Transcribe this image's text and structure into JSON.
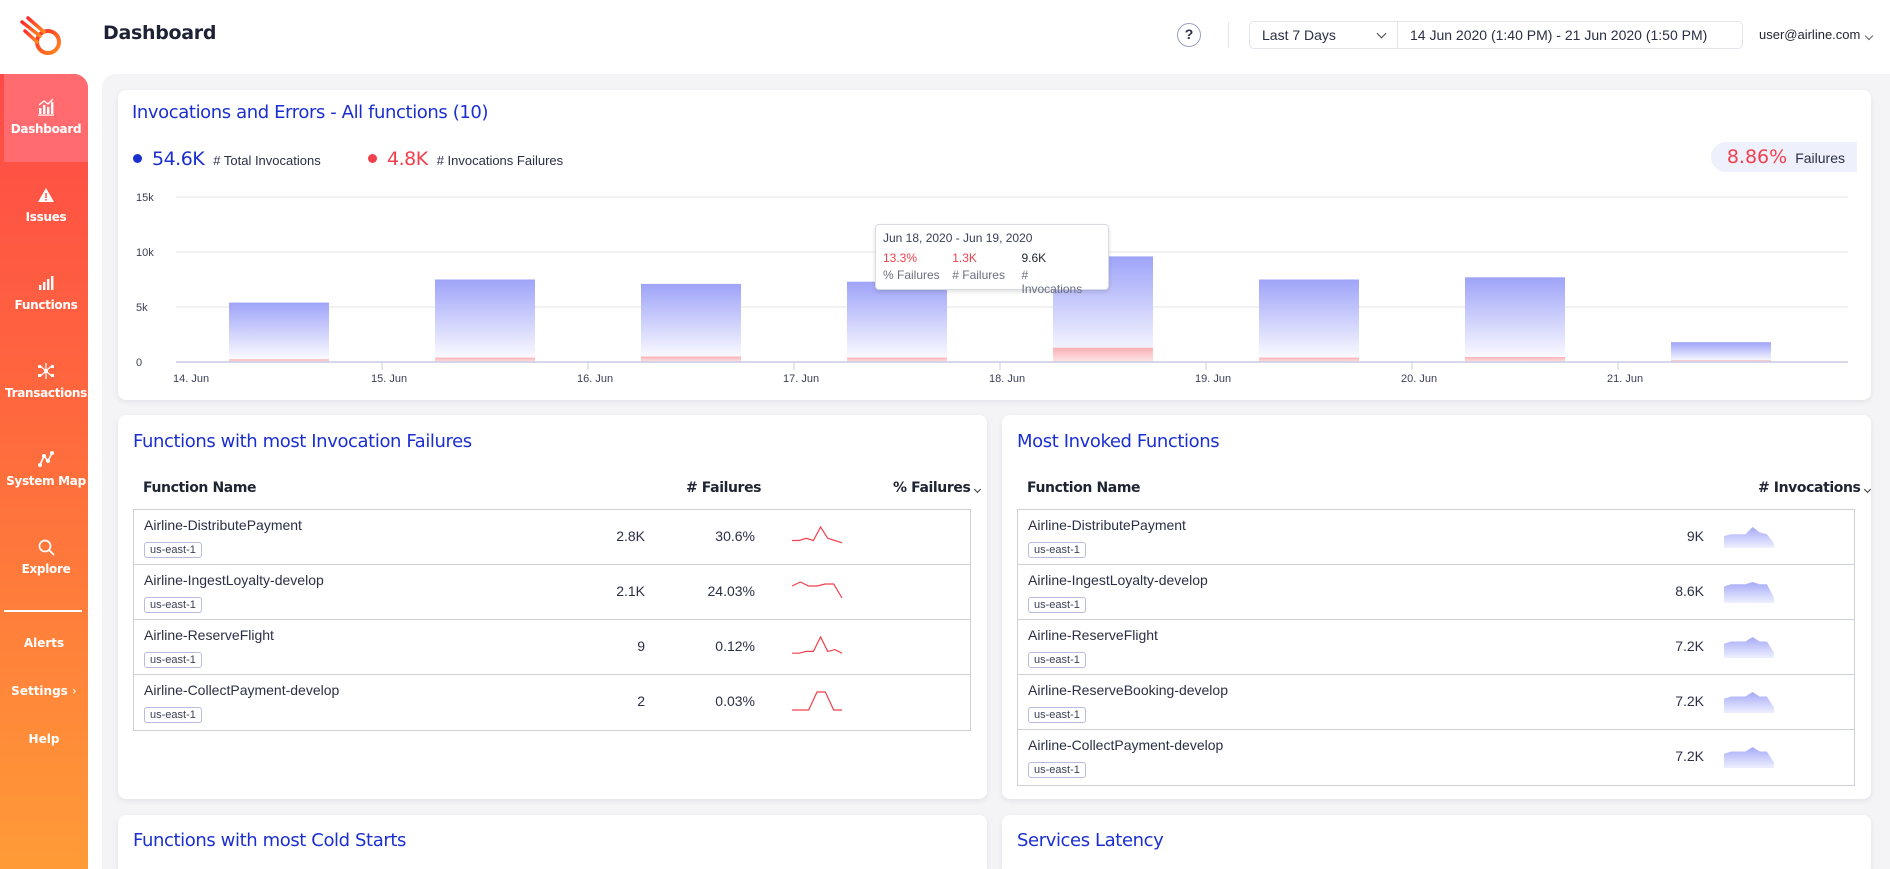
{
  "header": {
    "title": "Dashboard",
    "help_label": "?",
    "range_select": "Last 7 Days",
    "range_dates": "14 Jun 2020 (1:40 PM) - 21 Jun 2020 (1:50 PM)",
    "user": "user@airline.com"
  },
  "sidebar": {
    "items": [
      {
        "label": "Dashboard",
        "icon": "dashboard-chart-icon",
        "active": true
      },
      {
        "label": "Issues",
        "icon": "warning-icon"
      },
      {
        "label": "Functions",
        "icon": "bars-icon"
      },
      {
        "label": "Transactions",
        "icon": "transactions-icon"
      },
      {
        "label": "System Map",
        "icon": "system-map-icon"
      },
      {
        "label": "Explore",
        "icon": "search-icon"
      }
    ],
    "links": [
      {
        "label": "Alerts"
      },
      {
        "label": "Settings",
        "has_submenu": true
      },
      {
        "label": "Help"
      }
    ]
  },
  "invocations_card": {
    "title": "Invocations and Errors - All functions (10)",
    "total_invocations": "54.6K",
    "total_invocations_label": "# Total Invocations",
    "failures": "4.8K",
    "failures_label": "# Invocations Failures",
    "failure_pct": "8.86%",
    "failure_pct_label": "Failures",
    "colors": {
      "invocations": "#1b2fd1",
      "failures": "#f0404e"
    },
    "tooltip": {
      "date_range": "Jun 18, 2020 - Jun 19, 2020",
      "pct_failures": "13.3%",
      "pct_failures_label": "% Failures",
      "failures": "1.3K",
      "failures_label": "# Failures",
      "invocations": "9.6K",
      "invocations_label": "# Invocations"
    }
  },
  "chart_data": {
    "type": "bar",
    "title": "Invocations and Errors - All functions (10)",
    "categories": [
      "14. Jun",
      "15. Jun",
      "16. Jun",
      "17. Jun",
      "18. Jun",
      "19. Jun",
      "20. Jun",
      "21. Jun"
    ],
    "series": [
      {
        "name": "# Invocations",
        "values": [
          5400,
          7500,
          7100,
          7300,
          9600,
          7500,
          7700,
          1800
        ]
      },
      {
        "name": "# Failures",
        "values": [
          250,
          400,
          500,
          400,
          1300,
          400,
          450,
          150
        ]
      }
    ],
    "yticks": [
      "0",
      "5k",
      "10k",
      "15k"
    ],
    "ylim": [
      0,
      15000
    ],
    "xlabel": "",
    "ylabel": "",
    "grid": true,
    "legend": "top-left"
  },
  "failures_table": {
    "title": "Functions with most Invocation Failures",
    "headers": {
      "name": "Function Name",
      "failures": "# Failures",
      "pct": "% Failures"
    },
    "rows": [
      {
        "name": "Airline-DistributePayment",
        "region": "us-east-1",
        "failures": "2.8K",
        "pct": "30.6%",
        "spark": [
          2,
          2,
          3,
          2,
          8,
          3,
          2,
          1
        ]
      },
      {
        "name": "Airline-IngestLoyalty-develop",
        "region": "us-east-1",
        "failures": "2.1K",
        "pct": "24.03%",
        "spark": [
          7,
          9,
          7,
          7,
          8,
          8,
          1
        ]
      },
      {
        "name": "Airline-ReserveFlight",
        "region": "us-east-1",
        "failures": "9",
        "pct": "0.12%",
        "spark": [
          1,
          1,
          2,
          2,
          10,
          2,
          3,
          1
        ]
      },
      {
        "name": "Airline-CollectPayment-develop",
        "region": "us-east-1",
        "failures": "2",
        "pct": "0.03%",
        "spark": [
          0,
          0,
          0,
          10,
          10,
          0,
          0
        ]
      }
    ]
  },
  "invoked_table": {
    "title": "Most Invoked Functions",
    "headers": {
      "name": "Function Name",
      "invocations": "# Invocations"
    },
    "rows": [
      {
        "name": "Airline-DistributePayment",
        "region": "us-east-1",
        "invocations": "9K",
        "spark": [
          5,
          6,
          6,
          6,
          10,
          7,
          6,
          1
        ]
      },
      {
        "name": "Airline-IngestLoyalty-develop",
        "region": "us-east-1",
        "invocations": "8.6K",
        "spark": [
          6,
          7,
          7,
          7,
          8,
          7,
          7,
          1
        ]
      },
      {
        "name": "Airline-ReserveFlight",
        "region": "us-east-1",
        "invocations": "7.2K",
        "spark": [
          5,
          6,
          6,
          6,
          8,
          6,
          6,
          1
        ]
      },
      {
        "name": "Airline-ReserveBooking-develop",
        "region": "us-east-1",
        "invocations": "7.2K",
        "spark": [
          5,
          6,
          6,
          6,
          8,
          6,
          6,
          1
        ]
      },
      {
        "name": "Airline-CollectPayment-develop",
        "region": "us-east-1",
        "invocations": "7.2K",
        "spark": [
          5,
          6,
          6,
          6,
          8,
          6,
          6,
          1
        ]
      }
    ]
  },
  "bottom_cards": {
    "cold_starts_title": "Functions with most Cold Starts",
    "latency_title": "Services Latency"
  }
}
